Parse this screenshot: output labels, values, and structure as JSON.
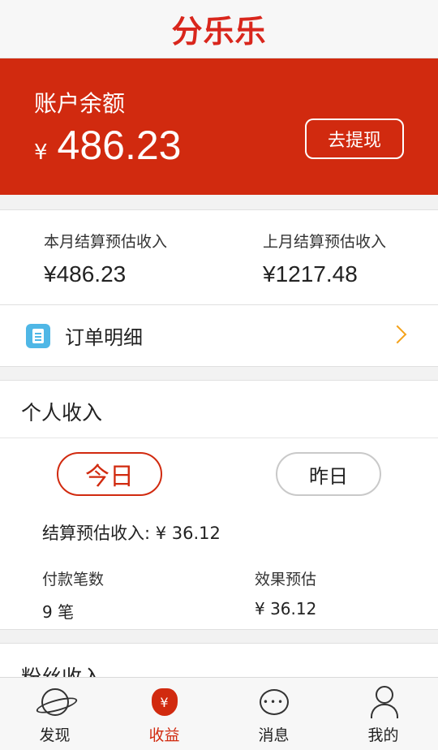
{
  "header": {
    "logo": "分乐乐"
  },
  "balance": {
    "label": "账户余额",
    "currency": "¥",
    "amount": "486.23",
    "withdraw_label": "去提现"
  },
  "estimates": {
    "this_month": {
      "label": "本月结算预估收入",
      "value": "¥486.23"
    },
    "last_month": {
      "label": "上月结算预估收入",
      "value": "¥1217.48"
    }
  },
  "orders": {
    "label": "订单明细"
  },
  "personal": {
    "title": "个人收入",
    "tabs": {
      "today": "今日",
      "yesterday": "昨日"
    },
    "settle_line": "结算预估收入: ¥ 36.12",
    "payments": {
      "label": "付款笔数",
      "value": "9 笔"
    },
    "effect": {
      "label": "效果预估",
      "value": "¥ 36.12"
    }
  },
  "fans": {
    "title": "粉丝收入"
  },
  "tabbar": {
    "discover": "发现",
    "income": "收益",
    "income_glyph": "¥",
    "messages": "消息",
    "messages_glyph": "•••",
    "mine": "我的"
  },
  "colors": {
    "accent": "#d12a0f",
    "chevron": "#f4a21b",
    "order_icon": "#4fb7e6"
  }
}
